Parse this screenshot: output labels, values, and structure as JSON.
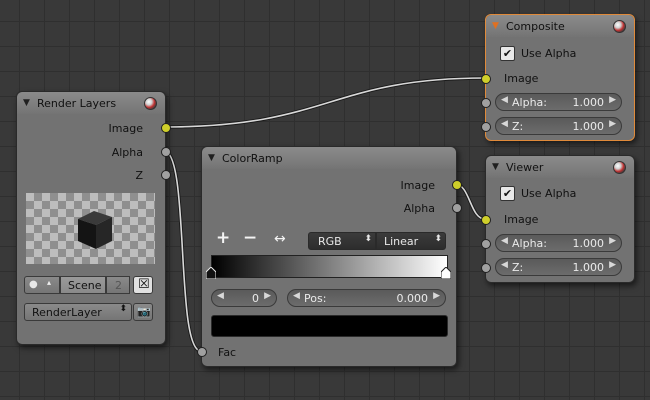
{
  "nodes": {
    "render_layers": {
      "title": "Render Layers",
      "outputs": {
        "image": "Image",
        "alpha": "Alpha",
        "z": "Z"
      },
      "scene_label": "Scene",
      "scene_users": "2",
      "layer_select": "RenderLayer"
    },
    "composite": {
      "title": "Composite",
      "use_alpha_label": "Use Alpha",
      "image_label": "Image",
      "alpha_label": "Alpha:",
      "alpha_value": "1.000",
      "z_label": "Z:",
      "z_value": "1.000"
    },
    "viewer": {
      "title": "Viewer",
      "use_alpha_label": "Use Alpha",
      "image_label": "Image",
      "alpha_label": "Alpha:",
      "alpha_value": "1.000",
      "z_label": "Z:",
      "z_value": "1.000"
    },
    "colorramp": {
      "title": "ColorRamp",
      "outputs": {
        "image": "Image",
        "alpha": "Alpha"
      },
      "add_glyph": "+",
      "remove_glyph": "−",
      "flip_glyph": "↔",
      "color_mode": "RGB",
      "interpolation": "Linear",
      "active_stop": "0",
      "pos_label": "Pos:",
      "pos_value": "0.000",
      "fac_label": "Fac"
    }
  },
  "colors": {
    "background": "#393939",
    "node_body": "#727272",
    "node_header": "#808080",
    "active_border": "#e08a3a",
    "socket_image": "#cfcf2a",
    "socket_value": "#a0a0a0",
    "link": "#d8d8d8"
  },
  "icons": {
    "collapse": "triangle-down-icon",
    "preview": "sphere-preview-icon",
    "scene": "scene-icon",
    "close": "x-icon",
    "render": "camera-icon"
  }
}
